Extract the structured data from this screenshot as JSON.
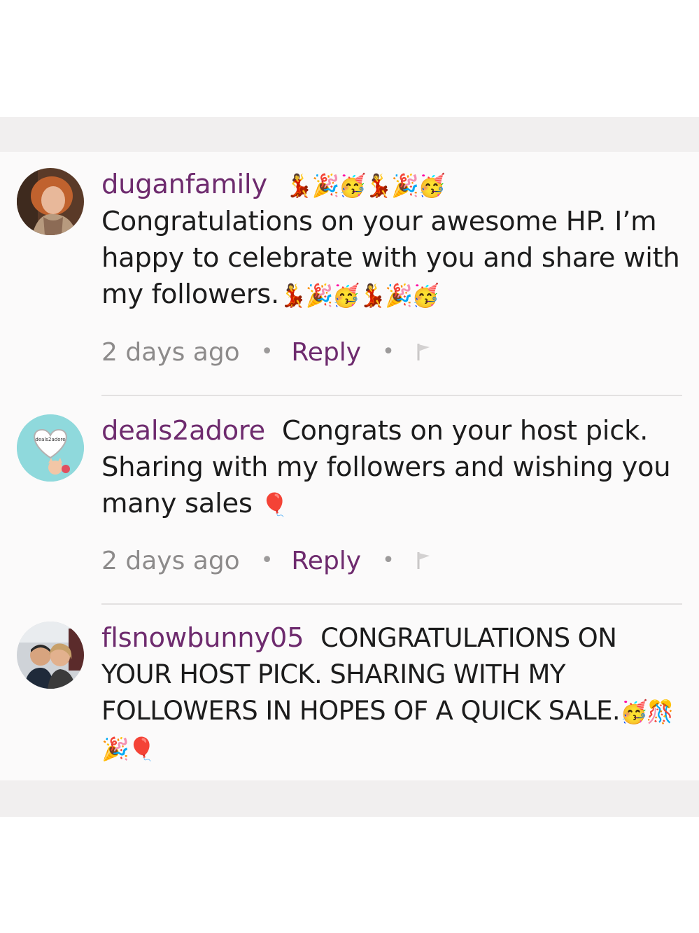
{
  "comments": [
    {
      "username": "duganfamily",
      "username_emoji": "💃🎉🥳💃🎉🥳",
      "text": "Congratulations on your awesome HP. I’m happy to celebrate with you and share with my followers.",
      "text_emoji": "💃🎉🥳💃🎉🥳",
      "time": "2 days ago",
      "reply_label": "Reply",
      "avatar_icon": "user-photo-avatar"
    },
    {
      "username": "deals2adore",
      "text": "Congrats on your host pick. Sharing with my followers and wishing you many sales",
      "text_emoji": "🎈",
      "avatar_label": "deals2adore",
      "time": "2 days ago",
      "reply_label": "Reply",
      "avatar_icon": "heart-logo-avatar"
    },
    {
      "username": "flsnowbunny05",
      "text": "CONGRATULATIONS ON YOUR HOST PICK. SHARING WITH MY FOLLOWERS IN HOPES OF A QUICK SALE.",
      "text_emoji": "🥳🎊🎉🎈",
      "avatar_icon": "couple-photo-avatar"
    }
  ],
  "colors": {
    "username": "#6e2b6e",
    "meta": "#8d8b8b",
    "panel": "#fbfafa",
    "band": "#f1efef"
  },
  "icons": {
    "separator": "•",
    "flag": "flag-icon"
  }
}
